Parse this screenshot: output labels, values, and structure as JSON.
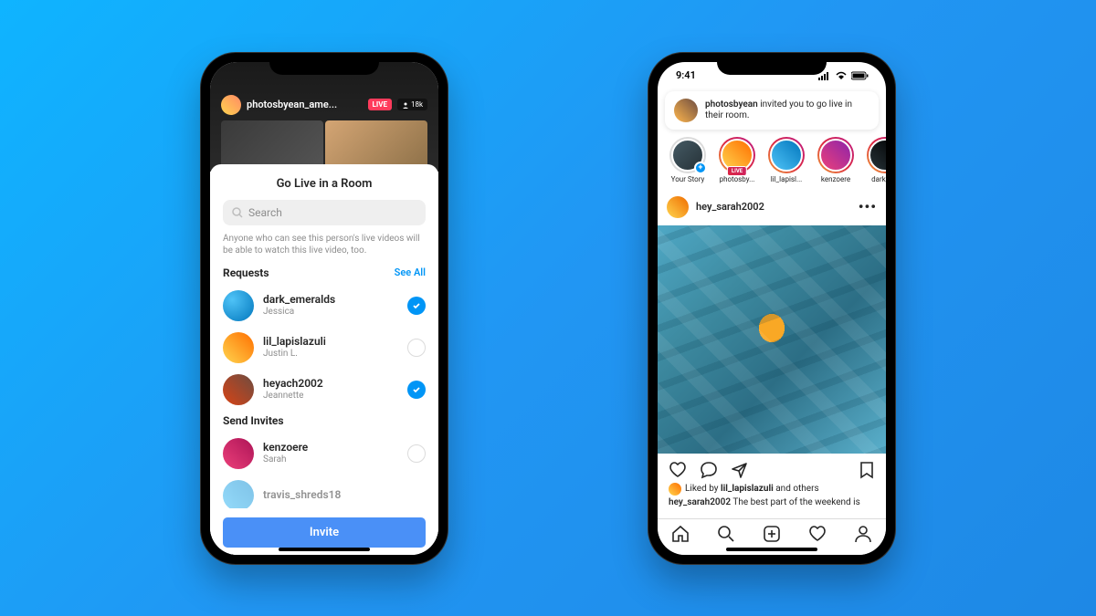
{
  "status_time": "9:41",
  "phone1": {
    "live_user": "photosbyean_ame...",
    "live_badge": "LIVE",
    "live_count": "18k",
    "sheet_title": "Go Live in a Room",
    "search_placeholder": "Search",
    "disclaimer": "Anyone who can see this person's live videos will be able to watch this live video, too.",
    "sections": {
      "requests_title": "Requests",
      "see_all": "See All",
      "send_invites_title": "Send Invites"
    },
    "requests": [
      {
        "username": "dark_emeralds",
        "name": "Jessica",
        "selected": true
      },
      {
        "username": "lil_lapislazuli",
        "name": "Justin L.",
        "selected": false
      },
      {
        "username": "heyach2002",
        "name": "Jeannette",
        "selected": true
      }
    ],
    "invites": [
      {
        "username": "kenzoere",
        "name": "Sarah",
        "selected": false
      },
      {
        "username": "travis_shreds18",
        "name": "",
        "selected": true
      }
    ],
    "invite_button": "Invite"
  },
  "phone2": {
    "notification": {
      "username": "photosbyean",
      "text": " invited you to go live in their room."
    },
    "stories": [
      {
        "label": "Your Story",
        "own": true
      },
      {
        "label": "photosby...",
        "live": true
      },
      {
        "label": "lil_lapisl..."
      },
      {
        "label": "kenzoere"
      },
      {
        "label": "dark_e..."
      }
    ],
    "post": {
      "username": "hey_sarah2002",
      "liked_by_prefix": "Liked by ",
      "liked_by_user": "lil_lapislazuli",
      "liked_by_suffix": " and others",
      "caption_user": "hey_sarah2002",
      "caption_text": " The best part of the weekend is"
    }
  }
}
